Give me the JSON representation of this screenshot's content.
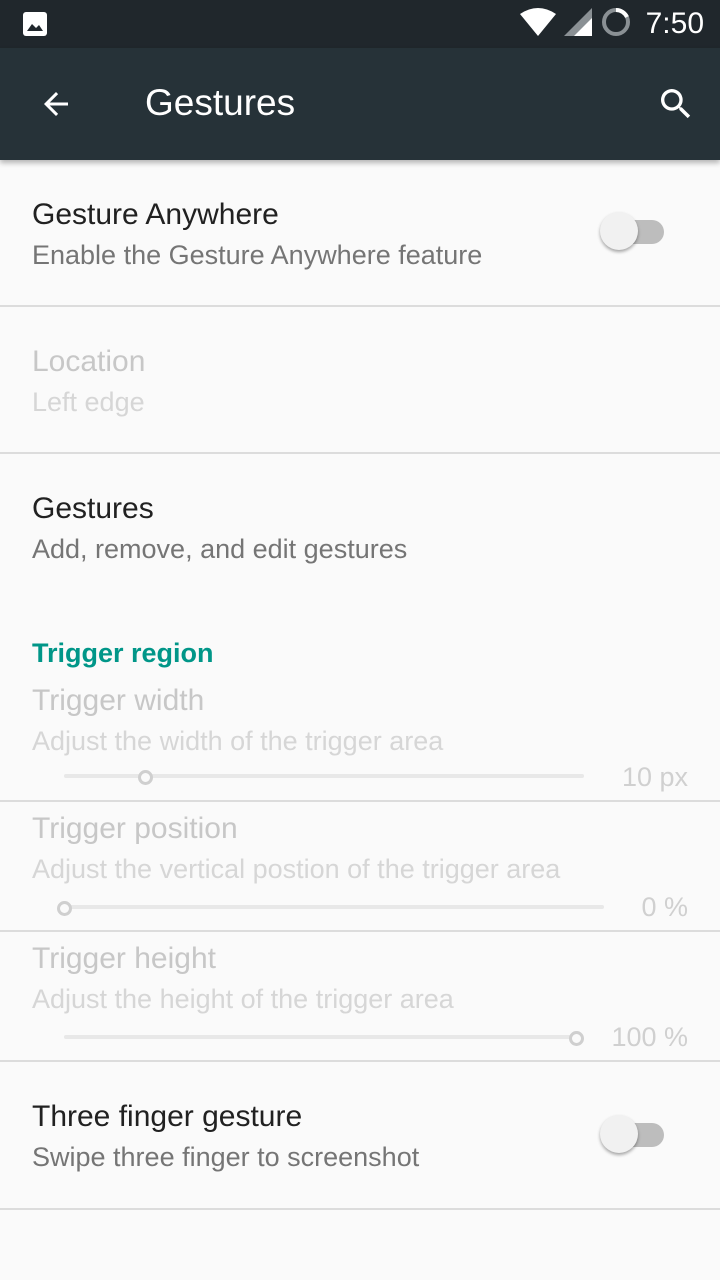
{
  "status_bar": {
    "time": "7:50",
    "icons": [
      "image-notification-icon",
      "wifi-icon",
      "signal-icon",
      "battery-charging-icon"
    ]
  },
  "app_bar": {
    "title": "Gestures",
    "back_icon": "arrow-back-icon",
    "search_icon": "search-icon"
  },
  "preferences": {
    "gesture_anywhere": {
      "title": "Gesture Anywhere",
      "summary": "Enable the Gesture Anywhere feature",
      "enabled": false
    },
    "location": {
      "title": "Location",
      "summary": "Left edge"
    },
    "gestures": {
      "title": "Gestures",
      "summary": "Add, remove, and edit gestures"
    },
    "trigger_region": {
      "category": "Trigger region",
      "width": {
        "title": "Trigger width",
        "summary": "Adjust the width of the trigger area",
        "value": "10",
        "unit": "px",
        "value_text": "10  px"
      },
      "position": {
        "title": "Trigger position",
        "summary": "Adjust the vertical postion of the trigger area",
        "value": "0",
        "unit": "%",
        "value_text": "0  %"
      },
      "height": {
        "title": "Trigger height",
        "summary": "Adjust the height of the trigger area",
        "value": "100",
        "unit": "%",
        "value_text": "100  %"
      }
    },
    "three_finger": {
      "title": "Three finger gesture",
      "summary": "Swipe three finger to screenshot",
      "enabled": false
    }
  },
  "colors": {
    "status_bar": "#20272c",
    "app_bar": "#263238",
    "accent": "#009688",
    "background": "#fafafa"
  }
}
